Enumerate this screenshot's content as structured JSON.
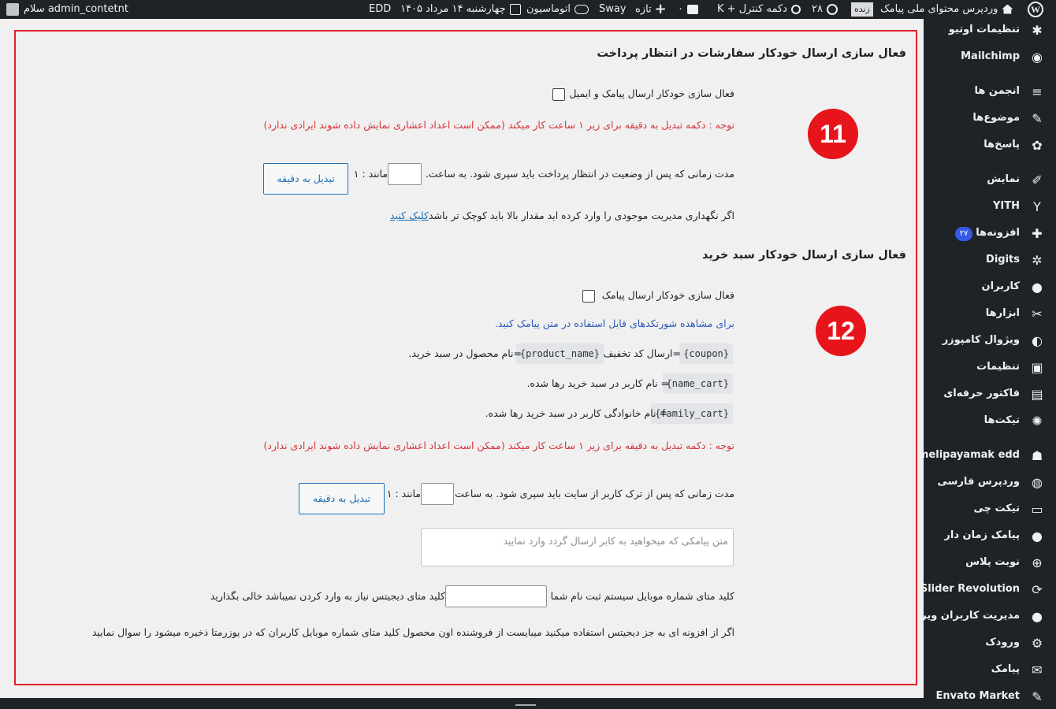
{
  "adminbar": {
    "greeting": "سلام admin_contetnt",
    "edd": "EDD",
    "date": "چهارشنبه ۱۴ مرداد ۱۴۰۵",
    "automation": "اتوماسیون",
    "sway": "Sway",
    "new": "تازه",
    "comments_count": "۰",
    "shortcut": "دکمه کنترل + K",
    "updates_count": "۲۸",
    "live_badge": "زنده",
    "site_name": "وردپرس محتوای ملی پیامک"
  },
  "sidebar": {
    "items": [
      {
        "label": "تنظیمات اوتیو",
        "icon": "asterisk-icon"
      },
      {
        "label": "Mailchimp",
        "icon": "mailchimp-icon"
      },
      {
        "label": "انجمن ها",
        "icon": "forum-icon"
      },
      {
        "label": "موضوع‌ها",
        "icon": "topics-icon"
      },
      {
        "label": "پاسخ‌ها",
        "icon": "replies-icon"
      },
      {
        "label": "نمایش",
        "icon": "appearance-icon"
      },
      {
        "label": "YITH",
        "icon": "yith-icon"
      },
      {
        "label": "افزونه‌ها",
        "icon": "plugins-icon",
        "badge": "۲۷"
      },
      {
        "label": "Digits",
        "icon": "digits-icon"
      },
      {
        "label": "کاربران",
        "icon": "users-icon"
      },
      {
        "label": "ابزارها",
        "icon": "tools-icon"
      },
      {
        "label": "ویژوال کامپوزر",
        "icon": "visual-composer-icon"
      },
      {
        "label": "تنظیمات",
        "icon": "settings-icon"
      },
      {
        "label": "فاکتور حرفه‌ای",
        "icon": "invoice-icon"
      },
      {
        "label": "تیکت‌ها",
        "icon": "tickets-icon"
      },
      {
        "label": "melipayamak edd",
        "icon": "melipayamak-icon"
      },
      {
        "label": "وردپرس فارسی",
        "icon": "wp-farsi-icon"
      },
      {
        "label": "تیکت چی",
        "icon": "ticket-chat-icon"
      },
      {
        "label": "پیامک زمان دار",
        "icon": "scheduled-sms-icon"
      },
      {
        "label": "نوبت پلاس",
        "icon": "plus-circle-icon"
      },
      {
        "label": "Slider Revolution",
        "icon": "slider-revolution-icon"
      },
      {
        "label": "مدیریت کاربران ویرا",
        "icon": "user-manage-icon"
      },
      {
        "label": "ورودک",
        "icon": "gear-icon"
      },
      {
        "label": "پیامک",
        "icon": "envelope-icon"
      },
      {
        "label": "Envato Market",
        "icon": "envato-icon"
      }
    ]
  },
  "section1": {
    "title": "فعال سازی ارسال خودکار سفارشات در انتظار پرداخت",
    "checkbox_label": "فعال سازی خودکار ارسال پیامک و ایمیل",
    "note": "توجه : دکمه تبدیل به دقیقه برای زیر ۱ ساعت کار میکند (ممکن است اعداد اعشاری نمایش داده شوند ایرادی ندارد)",
    "duration_label": "مدت زمانی که پس از وضعیت در انتظار پرداخت باید سپری شود. به ساعت.",
    "example": "مانند : ۱",
    "convert_button": "تبدیل به دقیقه",
    "stock_text": "اگر نگهداری مدیریت موجودی را وارد کرده اید مقدار بالا باید کوچک تر باشد",
    "stock_link": "کلیک کنید",
    "marker": "11"
  },
  "section2": {
    "title": "فعال سازی ارسال خودکار سبد خرید",
    "checkbox_label": "فعال سازی خودکار ارسال پیامک",
    "shortcodes_hint": "برای مشاهده شورتکدهای قابل استفاده در متن پیامک کنید.",
    "shortcodes": [
      {
        "code": "{coupon}",
        "desc": "=ارسال کد تخفیف"
      },
      {
        "code": "{product_name}",
        "desc": "=نام محصول در سبد خرید."
      },
      {
        "code": "{name_cart}",
        "desc": "= نام کاربر در سبد خرید رها شده."
      },
      {
        "code": "{family_cart}",
        "desc": "= نام خانوادگی کاربر در سبد خرید رها شده."
      }
    ],
    "note": "توجه : دکمه تبدیل به دقیقه برای زیر ۱ ساعت کار میکند (ممکن است اعداد اعشاری نمایش داده شوند ایرادی ندارد)",
    "duration_label": "مدت زمانی که پس از ترک کاربر از سایت باید سپری شود. به ساعت.",
    "example": "مانند : ۱",
    "convert_button": "تبدیل به دقیقه",
    "message_placeholder": "متن پیامکی که میخواهید به کابر ارسال گردد وارد نمایید",
    "meta_key_label": "کلید متای شماره موبایل سیستم ثبت نام شما",
    "meta_key_hint": "کلید متای دیجیتس نیاز به وارد کردن نمیباشد خالی بگذارید",
    "plugin_note": "اگر از افزونه ای به جز دیجیتس استفاده میکنید میبایست از فروشنده اون محصول کلید متای شماره موبایل کاربران که در یوزرمتا ذخیره میشود را سوال نمایید",
    "marker": "12"
  }
}
